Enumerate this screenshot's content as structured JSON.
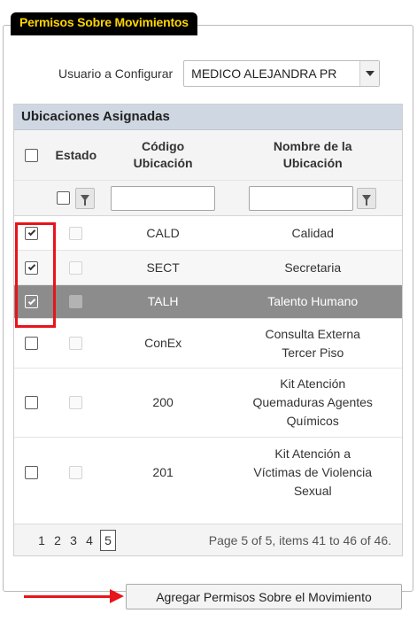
{
  "section_legend": "Permisos Sobre Movimientos",
  "user_label": "Usuario a Configurar",
  "user_value": "MEDICO ALEJANDRA PR",
  "grid": {
    "title": "Ubicaciones Asignadas",
    "columns": {
      "estado": "Estado",
      "codigo": "Código Ubicación",
      "nombre": "Nombre de la Ubicación"
    },
    "rows": [
      {
        "checked": true,
        "code": "CALD",
        "name": "Calidad"
      },
      {
        "checked": true,
        "code": "SECT",
        "name": "Secretaria"
      },
      {
        "checked": true,
        "code": "TALH",
        "name": "Talento Humano",
        "selected": true
      },
      {
        "checked": false,
        "code": "ConEx",
        "name": "Consulta Externa Tercer Piso"
      },
      {
        "checked": false,
        "code": "200",
        "name": "Kit Atención Quemaduras Agentes Químicos"
      },
      {
        "checked": false,
        "code": "201",
        "name": "Kit Atención a Víctimas de Violencia Sexual"
      }
    ]
  },
  "pager": {
    "pages": [
      "1",
      "2",
      "3",
      "4",
      "5"
    ],
    "current_page": "5",
    "info": "Page 5 of 5, items 41 to 46 of 46."
  },
  "action_button": "Agregar Permisos Sobre el Movimiento",
  "colors": {
    "legend_bg": "#000000",
    "legend_text": "#ffd500",
    "highlight": "#e8141b",
    "selected_row": "#8c8c8c"
  }
}
